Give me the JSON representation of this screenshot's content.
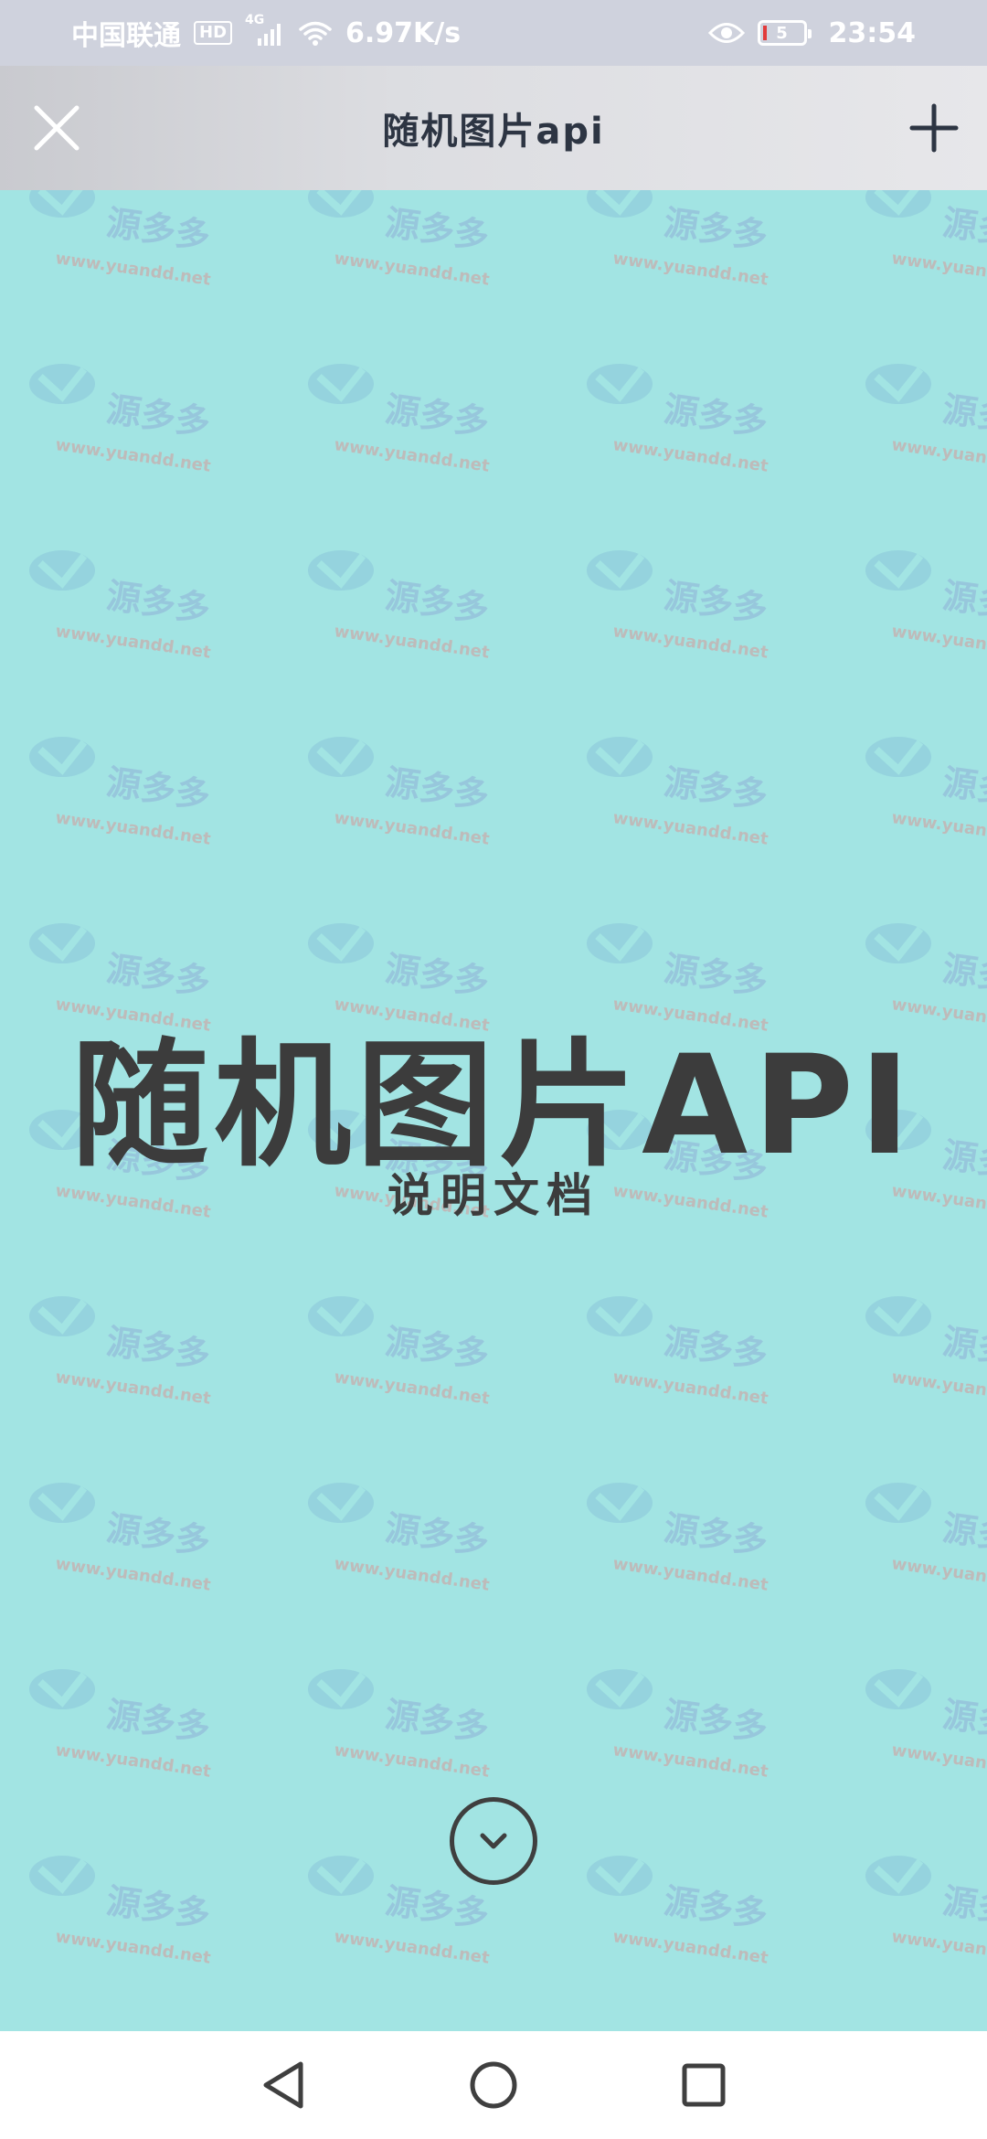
{
  "status_bar": {
    "carrier": "中国联通",
    "hd": "HD",
    "network": "4G",
    "speed": "6.97K/s",
    "battery": "5",
    "time": "23:54",
    "icons": [
      "signal-icon",
      "wifi-icon",
      "eye-icon",
      "battery-icon"
    ]
  },
  "title_bar": {
    "title": "随机图片api",
    "left_icon": "close-icon",
    "right_icon": "plus-icon"
  },
  "hero": {
    "title": "随机图片API",
    "subtitle": "说明文档",
    "background_color": "#a2e4e3",
    "scroll_icon": "chevron-down-icon"
  },
  "watermark": {
    "brand": "源多多",
    "url": "www.yuandd.net"
  },
  "nav_bar": {
    "icons": [
      "back-icon",
      "home-icon",
      "recents-icon"
    ]
  }
}
